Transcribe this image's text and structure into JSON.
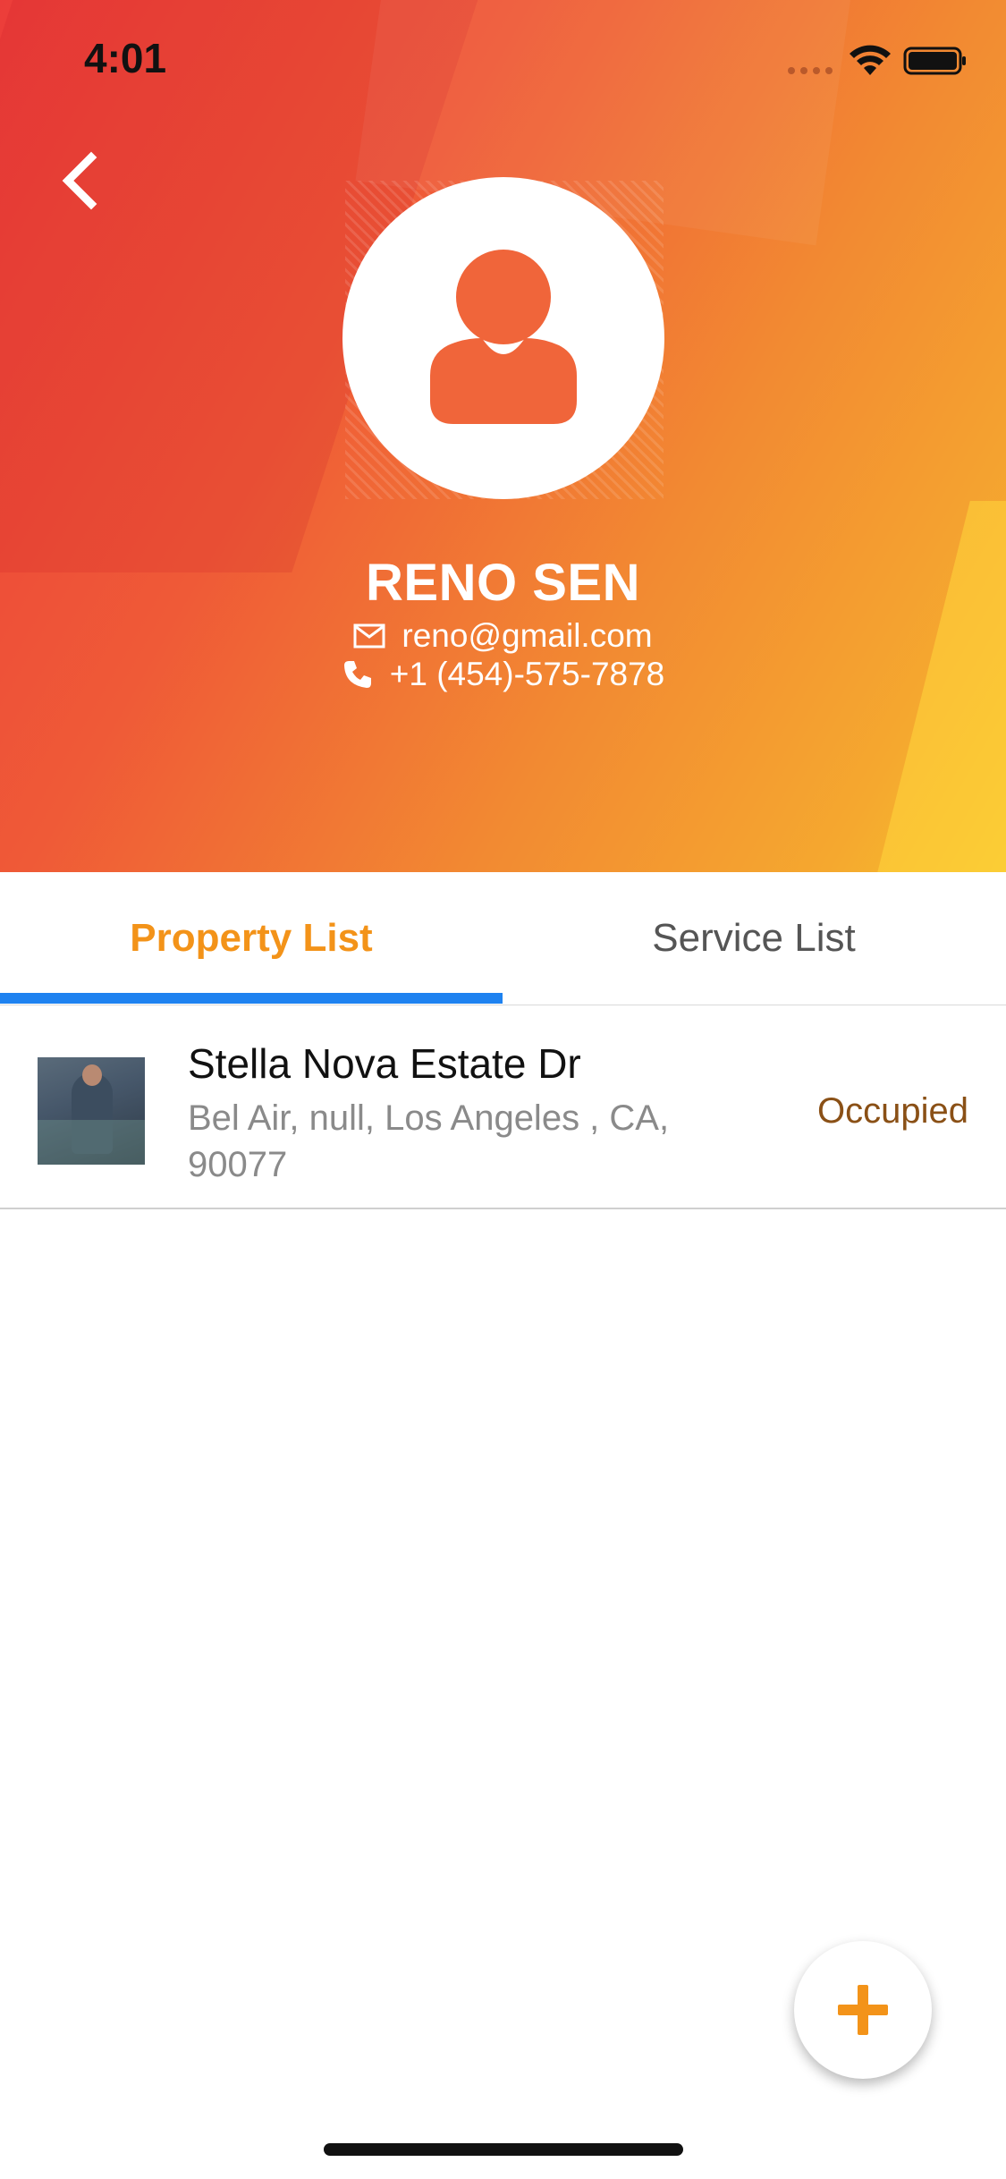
{
  "status_bar": {
    "time": "4:01"
  },
  "header": {
    "back_icon": "chevron-left-icon",
    "avatar_icon": "user-icon",
    "name": "RENO SEN",
    "email_icon": "mail-icon",
    "email": "reno@gmail.com",
    "phone_icon": "phone-icon",
    "phone": "+1 (454)-575-7878",
    "gradient_colors": [
      "#ec3d3a",
      "#f28a32",
      "#f6c22d"
    ]
  },
  "tabs": [
    {
      "label": "Property List",
      "active": true
    },
    {
      "label": "Service List",
      "active": false
    }
  ],
  "tab_colors": {
    "active_text": "#f39319",
    "indicator": "#1e82f0"
  },
  "properties": [
    {
      "title": "Stella Nova Estate Dr",
      "address": "Bel Air, null, Los Angeles , CA, 90077",
      "status": "Occupied"
    }
  ],
  "fab": {
    "icon": "plus-icon",
    "color": "#f39319"
  }
}
